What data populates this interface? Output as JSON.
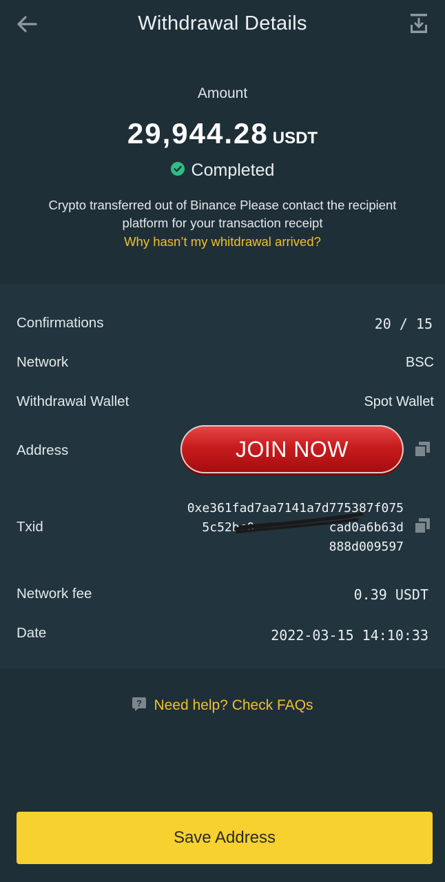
{
  "header": {
    "title": "Withdrawal Details",
    "back_icon": "arrow-left-icon",
    "download_icon": "download-icon"
  },
  "summary": {
    "amount_label": "Amount",
    "amount_value": "29,944.28",
    "amount_unit": "USDT",
    "status": "Completed",
    "status_icon": "check-circle-icon",
    "notice": "Crypto transferred out of Binance Please contact the recipient platform for your transaction receipt",
    "why_link": "Why hasn’t my whitdrawal arrived?"
  },
  "details": {
    "confirmations_label": "Confirmations",
    "confirmations_value": "20 / 15",
    "network_label": "Network",
    "network_value": "BSC",
    "wallet_label": "Withdrawal Wallet",
    "wallet_value": "Spot Wallet",
    "address_label": "Address",
    "txid_label": "Txid",
    "txid_line1": "0xe361fad7aa7141a7d775387f075",
    "txid_line2": "5c52bc0          cad0a6b63d",
    "txid_line3": "888d009597",
    "fee_label": "Network fee",
    "fee_value": "0.39 USDT",
    "date_label": "Date",
    "date_value": "2022-03-15 14:10:33"
  },
  "overlay": {
    "join_label": "JOIN NOW"
  },
  "help": {
    "label": "Need help? Check FAQs",
    "icon": "question-icon"
  },
  "footer": {
    "save_label": "Save Address"
  },
  "colors": {
    "background": "#1f2f38",
    "panel": "#22343e",
    "accent_yellow": "#f0c02d",
    "button_yellow": "#f6d130",
    "success_green": "#2ebd85"
  }
}
